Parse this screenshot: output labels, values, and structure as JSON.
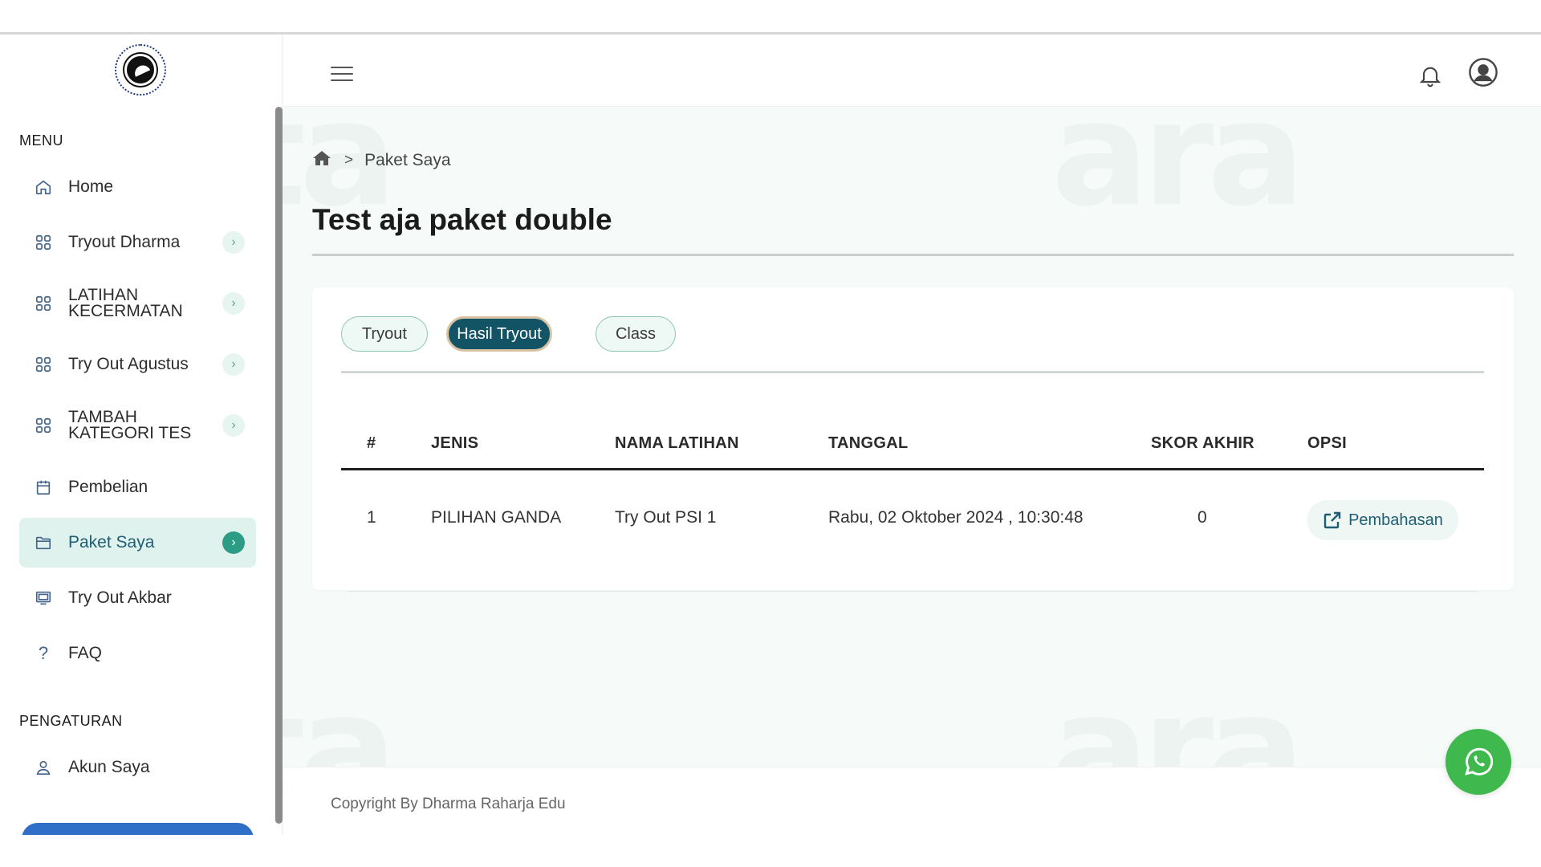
{
  "sidebar": {
    "menu_label": "MENU",
    "settings_label": "PENGATURAN",
    "items": [
      {
        "label": "Home",
        "icon": "home-icon"
      },
      {
        "label": "Tryout Dharma",
        "icon": "grid-icon"
      },
      {
        "label": "LATIHAN KECERMATAN",
        "icon": "grid-icon"
      },
      {
        "label": "Try Out Agustus",
        "icon": "grid-icon"
      },
      {
        "label": "TAMBAH KATEGORI TES",
        "icon": "grid-icon"
      },
      {
        "label": "Pembelian",
        "icon": "calendar-icon"
      },
      {
        "label": "Paket Saya",
        "icon": "folder-icon",
        "active": true
      },
      {
        "label": "Try Out Akbar",
        "icon": "monitor-icon"
      },
      {
        "label": "FAQ",
        "icon": "question-icon"
      }
    ],
    "settings_items": [
      {
        "label": "Akun Saya",
        "icon": "user-icon"
      }
    ]
  },
  "breadcrumb": {
    "current": "Paket Saya",
    "separator": ">"
  },
  "page": {
    "title": "Test aja paket double"
  },
  "tabs": [
    {
      "label": "Tryout"
    },
    {
      "label": "Hasil Tryout",
      "active": true
    },
    {
      "label": "Class"
    }
  ],
  "table": {
    "headers": [
      "#",
      "JENIS",
      "NAMA LATIHAN",
      "TANGGAL",
      "SKOR AKHIR",
      "OPSI"
    ],
    "rows": [
      {
        "no": "1",
        "jenis": "PILIHAN GANDA",
        "nama": "Try Out PSI 1",
        "tanggal": "Rabu, 02 Oktober 2024 , 10:30:48",
        "skor": "0",
        "opsi": "Pembahasan"
      }
    ]
  },
  "footer": {
    "copyright": "Copyright By Dharma Raharja Edu"
  },
  "colors": {
    "accent": "#125466",
    "active_bg": "#dff2ee",
    "whatsapp": "#3fb94d"
  }
}
